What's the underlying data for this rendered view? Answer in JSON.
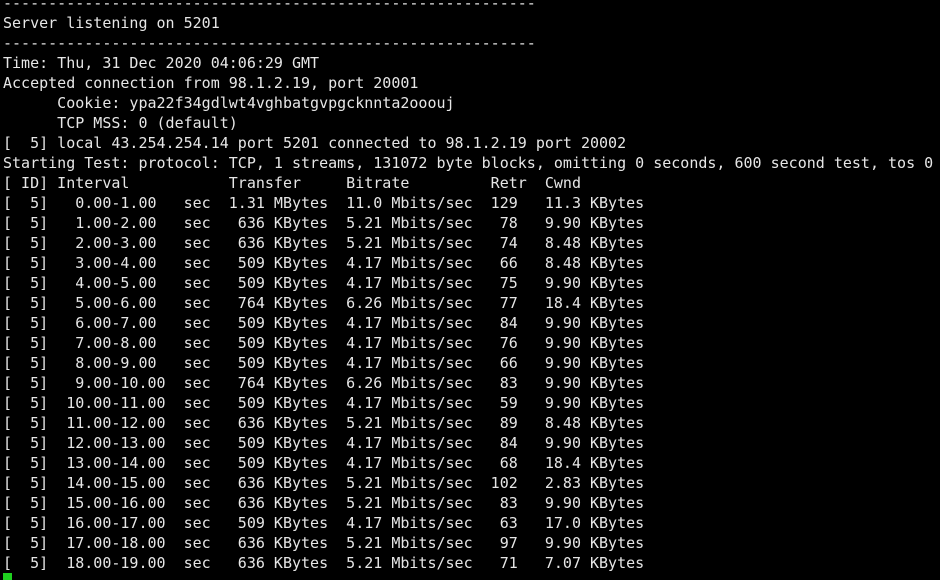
{
  "terminal": {
    "lines": [
      "-----------------------------------------------------------",
      "Server listening on 5201",
      "-----------------------------------------------------------",
      "Time: Thu, 31 Dec 2020 04:06:29 GMT",
      "Accepted connection from 98.1.2.19, port 20001",
      "      Cookie: ypa22f34gdlwt4vghbatgvpgcknnta2ooouj",
      "      TCP MSS: 0 (default)",
      "[  5] local 43.254.254.14 port 5201 connected to 98.1.2.19 port 20002",
      "Starting Test: protocol: TCP, 1 streams, 131072 byte blocks, omitting 0 seconds, 600 second test, tos 0",
      "[ ID] Interval           Transfer     Bitrate         Retr  Cwnd",
      "[  5]   0.00-1.00   sec  1.31 MBytes  11.0 Mbits/sec  129   11.3 KBytes",
      "[  5]   1.00-2.00   sec   636 KBytes  5.21 Mbits/sec   78   9.90 KBytes",
      "[  5]   2.00-3.00   sec   636 KBytes  5.21 Mbits/sec   74   8.48 KBytes",
      "[  5]   3.00-4.00   sec   509 KBytes  4.17 Mbits/sec   66   8.48 KBytes",
      "[  5]   4.00-5.00   sec   509 KBytes  4.17 Mbits/sec   75   9.90 KBytes",
      "[  5]   5.00-6.00   sec   764 KBytes  6.26 Mbits/sec   77   18.4 KBytes",
      "[  5]   6.00-7.00   sec   509 KBytes  4.17 Mbits/sec   84   9.90 KBytes",
      "[  5]   7.00-8.00   sec   509 KBytes  4.17 Mbits/sec   76   9.90 KBytes",
      "[  5]   8.00-9.00   sec   509 KBytes  4.17 Mbits/sec   66   9.90 KBytes",
      "[  5]   9.00-10.00  sec   764 KBytes  6.26 Mbits/sec   83   9.90 KBytes",
      "[  5]  10.00-11.00  sec   509 KBytes  4.17 Mbits/sec   59   9.90 KBytes",
      "[  5]  11.00-12.00  sec   636 KBytes  5.21 Mbits/sec   89   8.48 KBytes",
      "[  5]  12.00-13.00  sec   509 KBytes  4.17 Mbits/sec   84   9.90 KBytes",
      "[  5]  13.00-14.00  sec   509 KBytes  4.17 Mbits/sec   68   18.4 KBytes",
      "[  5]  14.00-15.00  sec   636 KBytes  5.21 Mbits/sec  102   2.83 KBytes",
      "[  5]  15.00-16.00  sec   636 KBytes  5.21 Mbits/sec   83   9.90 KBytes",
      "[  5]  16.00-17.00  sec   509 KBytes  4.17 Mbits/sec   63   17.0 KBytes",
      "[  5]  17.00-18.00  sec   636 KBytes  5.21 Mbits/sec   97   9.90 KBytes",
      "[  5]  18.00-19.00  sec   636 KBytes  5.21 Mbits/sec   71   7.07 KBytes"
    ]
  },
  "colors": {
    "background": "#000000",
    "text": "#e6e6e6",
    "cursor": "#1fd11f"
  }
}
